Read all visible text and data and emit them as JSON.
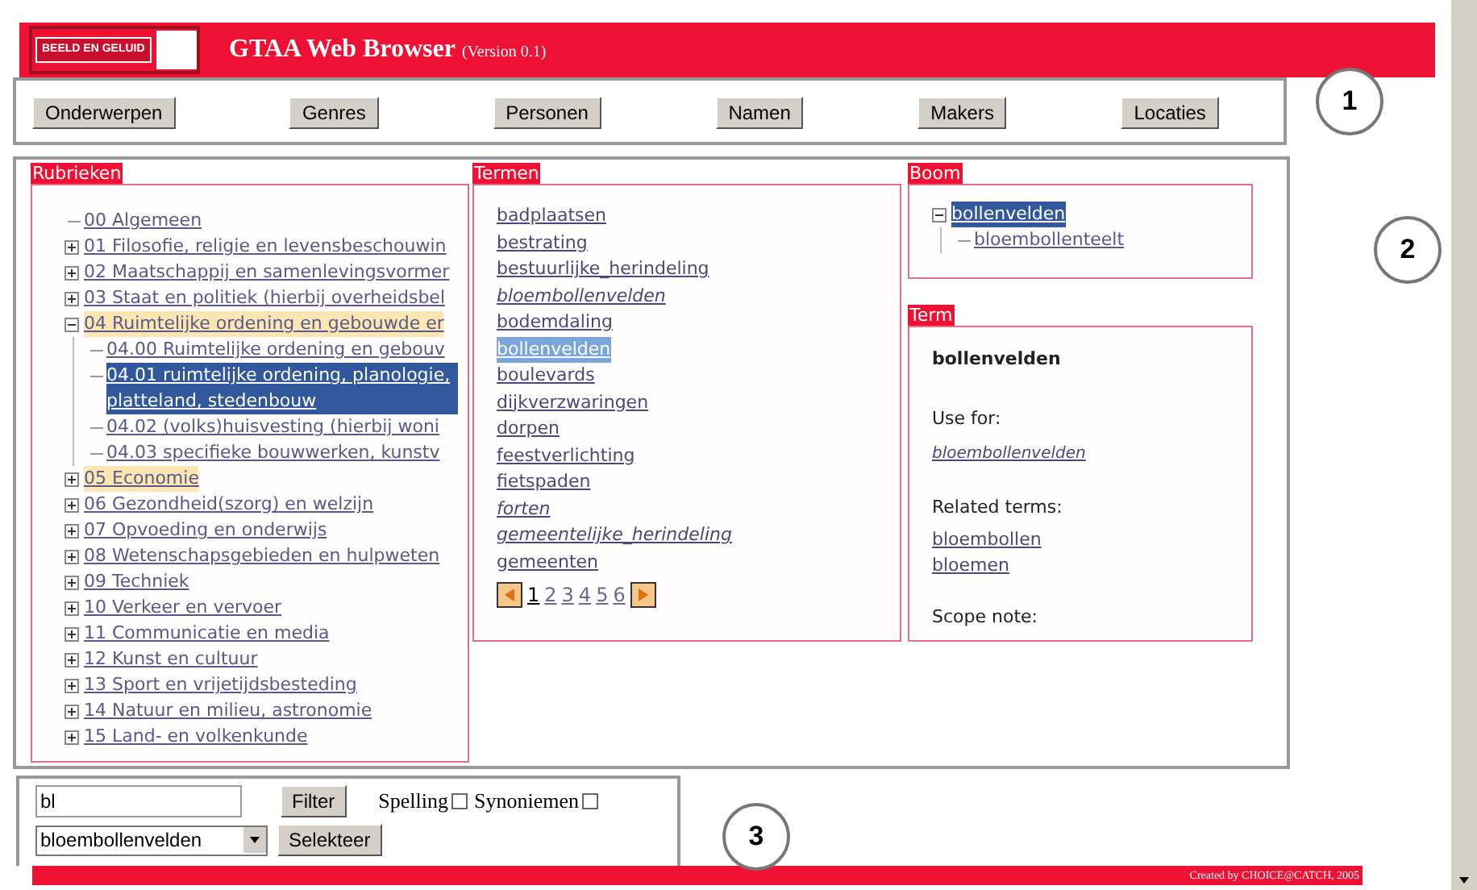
{
  "header": {
    "logo": "BEELD EN GELUID",
    "title": "GTAA Web Browser",
    "version": "(Version 0.1)"
  },
  "nav": [
    "Onderwerpen",
    "Genres",
    "Personen",
    "Namen",
    "Makers",
    "Locaties"
  ],
  "rubrieken": {
    "label": "Rubrieken",
    "items": [
      {
        "label": "00 Algemeen",
        "kind": "leaf",
        "highlighted": false,
        "selected": false
      },
      {
        "label": "01 Filosofie, religie en levensbeschouwin",
        "expanded": false,
        "highlighted": false,
        "selected": false
      },
      {
        "label": "02 Maatschappij en samenlevingsvormer",
        "expanded": false,
        "highlighted": false,
        "selected": false
      },
      {
        "label": "03 Staat en politiek (hierbij overheidsbel",
        "expanded": false,
        "highlighted": false,
        "selected": false
      },
      {
        "label": "04 Ruimtelijke ordening en gebouwde er",
        "expanded": true,
        "highlighted": true,
        "selected": false,
        "children": [
          {
            "label": "04.00 Ruimtelijke ordening en gebouv",
            "kind": "leaf",
            "selected": false
          },
          {
            "label": "04.01 ruimtelijke ordening, planologie, platteland, stedenbouw",
            "kind": "leaf",
            "selected": true
          },
          {
            "label": "04.02 (volks)huisvesting (hierbij woni",
            "kind": "leaf",
            "selected": false
          },
          {
            "label": "04.03 specifieke bouwwerken, kunstv",
            "kind": "leaf",
            "selected": false
          }
        ]
      },
      {
        "label": "05 Economie",
        "expanded": false,
        "highlighted": true,
        "selected": false
      },
      {
        "label": "06 Gezondheid(szorg) en welzijn",
        "expanded": false,
        "highlighted": false,
        "selected": false
      },
      {
        "label": "07 Opvoeding en onderwijs",
        "expanded": false,
        "highlighted": false,
        "selected": false
      },
      {
        "label": "08 Wetenschapsgebieden en hulpweten",
        "expanded": false,
        "highlighted": false,
        "selected": false
      },
      {
        "label": "09 Techniek",
        "expanded": false,
        "highlighted": false,
        "selected": false
      },
      {
        "label": "10 Verkeer en vervoer",
        "expanded": false,
        "highlighted": false,
        "selected": false
      },
      {
        "label": "11 Communicatie en media",
        "expanded": false,
        "highlighted": false,
        "selected": false
      },
      {
        "label": "12 Kunst en cultuur",
        "expanded": false,
        "highlighted": false,
        "selected": false
      },
      {
        "label": "13 Sport en vrijetijdsbesteding",
        "expanded": false,
        "highlighted": false,
        "selected": false
      },
      {
        "label": "14 Natuur en milieu, astronomie",
        "expanded": false,
        "highlighted": false,
        "selected": false
      },
      {
        "label": "15 Land- en volkenkunde",
        "expanded": false,
        "highlighted": false,
        "selected": false
      }
    ]
  },
  "termen": {
    "label": "Termen",
    "items": [
      {
        "label": "badplaatsen",
        "italic": false,
        "selected": false
      },
      {
        "label": "bestrating",
        "italic": false,
        "selected": false
      },
      {
        "label": "bestuurlijke_herindeling",
        "italic": false,
        "selected": false
      },
      {
        "label": "bloembollenvelden",
        "italic": true,
        "selected": false
      },
      {
        "label": "bodemdaling",
        "italic": false,
        "selected": false
      },
      {
        "label": "bollenvelden",
        "italic": false,
        "selected": true
      },
      {
        "label": "boulevards",
        "italic": false,
        "selected": false
      },
      {
        "label": "dijkverzwaringen",
        "italic": false,
        "selected": false
      },
      {
        "label": "dorpen",
        "italic": false,
        "selected": false
      },
      {
        "label": "feestverlichting",
        "italic": false,
        "selected": false
      },
      {
        "label": "fietspaden",
        "italic": false,
        "selected": false
      },
      {
        "label": "forten",
        "italic": true,
        "selected": false
      },
      {
        "label": "gemeentelijke_herindeling",
        "italic": true,
        "selected": false
      },
      {
        "label": "gemeenten",
        "italic": false,
        "selected": false
      }
    ],
    "pages": [
      {
        "label": "1",
        "selected": true
      },
      {
        "label": "2",
        "selected": false
      },
      {
        "label": "3",
        "selected": false
      },
      {
        "label": "4",
        "selected": false
      },
      {
        "label": "5",
        "selected": false
      },
      {
        "label": "6",
        "selected": false
      }
    ]
  },
  "boom": {
    "label": "Boom",
    "items": [
      {
        "label": "bollenvelden",
        "expanded": true,
        "selected": true,
        "children": [
          {
            "label": "bloembollenteelt",
            "kind": "leaf",
            "selected": false
          }
        ]
      }
    ]
  },
  "term": {
    "label": "Term",
    "name": "bollenvelden",
    "use_for_label": "Use for:",
    "use_for": [
      "bloembollenvelden"
    ],
    "related_label": "Related terms:",
    "related": [
      "bloembollen",
      "bloemen"
    ],
    "scope_label": "Scope note:"
  },
  "filter": {
    "value": "bl",
    "button": "Filter",
    "checks": [
      {
        "label": "Spelling",
        "checked": false
      },
      {
        "label": "Synoniemen",
        "checked": false
      }
    ],
    "select": "bloembollenvelden",
    "select_button": "Selekteer"
  },
  "footer": "Created by CHOICE@CATCH, 2005",
  "annotations": [
    "1",
    "2",
    "3"
  ]
}
